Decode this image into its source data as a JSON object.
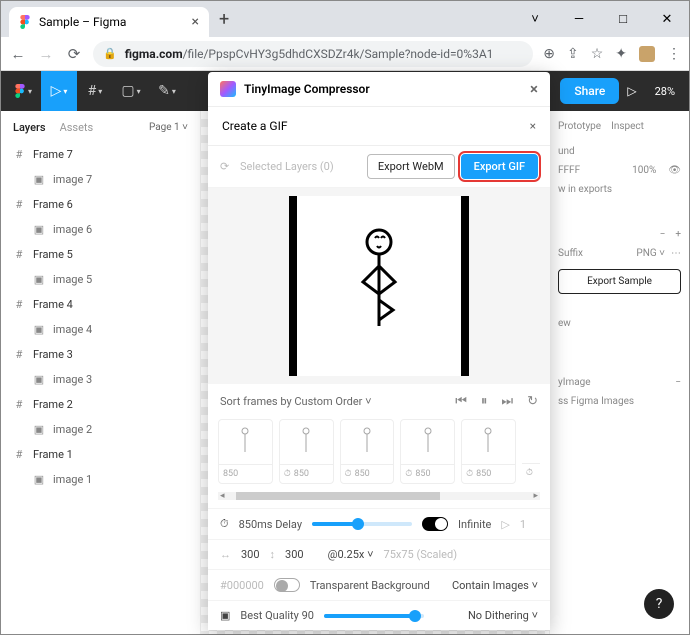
{
  "browser": {
    "tab_title": "Sample – Figma",
    "url_host": "figma.com",
    "url_path": "/file/PpspCvHY3g5dhdCXSDZr4k/Sample?node-id=0%3A1"
  },
  "figma": {
    "share": "Share",
    "zoom": "28%",
    "left": {
      "tab_layers": "Layers",
      "tab_assets": "Assets",
      "page_label": "Page 1",
      "layers": [
        {
          "frame": "Frame 7",
          "image": "image 7"
        },
        {
          "frame": "Frame 6",
          "image": "image 6"
        },
        {
          "frame": "Frame 5",
          "image": "image 5"
        },
        {
          "frame": "Frame 4",
          "image": "image 4"
        },
        {
          "frame": "Frame 3",
          "image": "image 3"
        },
        {
          "frame": "Frame 2",
          "image": "image 2"
        },
        {
          "frame": "Frame 1",
          "image": "image 1"
        }
      ]
    },
    "right": {
      "tab_prototype": "Prototype",
      "tab_inspect": "Inspect",
      "bg_label": "und",
      "color": "FFFF",
      "opacity": "100%",
      "exports_label": "w in exports",
      "suffix": "Suffix",
      "png": "PNG",
      "export_btn": "Export Sample",
      "view": "ew",
      "tinylabel": "yImage",
      "compress": "ss Figma Images"
    }
  },
  "plugin": {
    "title": "TinyImage Compressor",
    "subtitle": "Create a GIF",
    "selected": "Selected Layers (0)",
    "btn_webm": "Export WebM",
    "btn_gif": "Export GIF",
    "sort_label": "Sort frames by Custom Order",
    "thumb_ms": "850",
    "delay_label": "850ms Delay",
    "infinite": "Infinite",
    "dim_w": "300",
    "dim_h": "300",
    "scale": "@0.25x",
    "scaled": "75x75 (Scaled)",
    "tint": "#000000",
    "transparent": "Transparent Background",
    "contain": "Contain Images",
    "quality": "Best Quality 90",
    "dither": "No Dithering"
  }
}
